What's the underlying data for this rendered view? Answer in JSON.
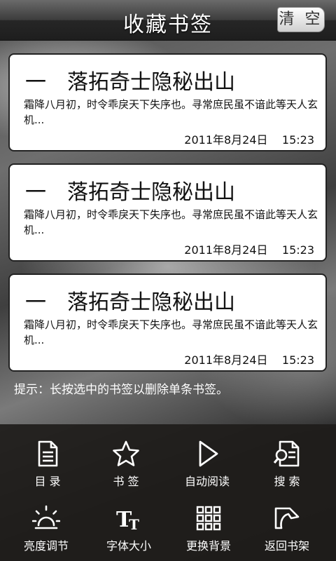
{
  "header": {
    "title": "收藏书签",
    "clear_label": "清 空"
  },
  "bookmarks": [
    {
      "title": "一　落拓奇士隐秘出山",
      "excerpt": "霜降八月初，时令乖戾天下失序也。寻常庶民虽不谙此等天人玄机...",
      "date": "2011年8月24日",
      "time": "15:23"
    },
    {
      "title": "一　落拓奇士隐秘出山",
      "excerpt": "霜降八月初，时令乖戾天下失序也。寻常庶民虽不谙此等天人玄机...",
      "date": "2011年8月24日",
      "time": "15:23"
    },
    {
      "title": "一　落拓奇士隐秘出山",
      "excerpt": "霜降八月初，时令乖戾天下失序也。寻常庶民虽不谙此等天人玄机...",
      "date": "2011年8月24日",
      "time": "15:23"
    }
  ],
  "hint": "提示：长按选中的书签以删除单条书签。",
  "toolbar": {
    "items": [
      {
        "label": "目 录",
        "icon": "document-icon"
      },
      {
        "label": "书 签",
        "icon": "star-icon"
      },
      {
        "label": "自动阅读",
        "icon": "play-icon"
      },
      {
        "label": "搜 索",
        "icon": "search-document-icon"
      },
      {
        "label": "亮度调节",
        "icon": "sun-icon"
      },
      {
        "label": "字体大小",
        "icon": "font-size-icon"
      },
      {
        "label": "更换背景",
        "icon": "grid-icon"
      },
      {
        "label": "返回书架",
        "icon": "return-icon"
      }
    ]
  }
}
